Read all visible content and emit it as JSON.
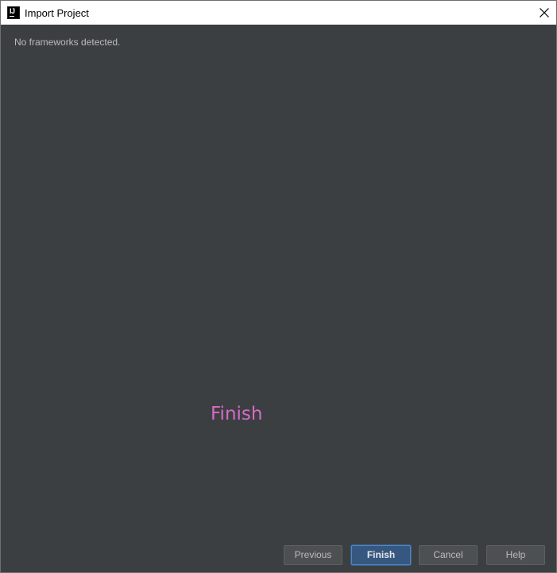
{
  "window": {
    "title": "Import Project",
    "app_icon": "intellij-idea-icon",
    "close_icon": "close-icon"
  },
  "content": {
    "status": "No frameworks detected.",
    "overlay_label": "Finish"
  },
  "buttons": {
    "previous": "Previous",
    "finish": "Finish",
    "cancel": "Cancel",
    "help": "Help"
  },
  "colors": {
    "background": "#3c3f41",
    "titlebar": "#ffffff",
    "text": "#bbbbbb",
    "overlay": "#d66bc8",
    "primary_button": "#365880"
  }
}
